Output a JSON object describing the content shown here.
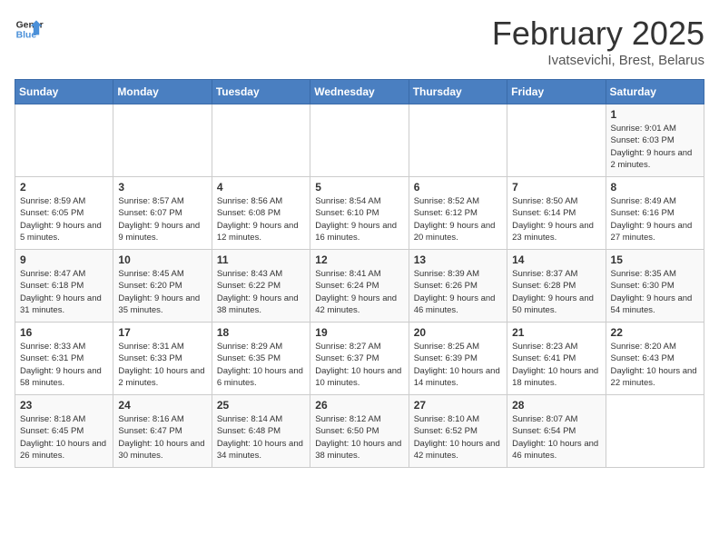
{
  "logo": {
    "line1": "General",
    "line2": "Blue"
  },
  "title": "February 2025",
  "subtitle": "Ivatsevichi, Brest, Belarus",
  "header": {
    "days": [
      "Sunday",
      "Monday",
      "Tuesday",
      "Wednesday",
      "Thursday",
      "Friday",
      "Saturday"
    ]
  },
  "weeks": [
    [
      {
        "day": "",
        "info": ""
      },
      {
        "day": "",
        "info": ""
      },
      {
        "day": "",
        "info": ""
      },
      {
        "day": "",
        "info": ""
      },
      {
        "day": "",
        "info": ""
      },
      {
        "day": "",
        "info": ""
      },
      {
        "day": "1",
        "info": "Sunrise: 9:01 AM\nSunset: 6:03 PM\nDaylight: 9 hours and 2 minutes."
      }
    ],
    [
      {
        "day": "2",
        "info": "Sunrise: 8:59 AM\nSunset: 6:05 PM\nDaylight: 9 hours and 5 minutes."
      },
      {
        "day": "3",
        "info": "Sunrise: 8:57 AM\nSunset: 6:07 PM\nDaylight: 9 hours and 9 minutes."
      },
      {
        "day": "4",
        "info": "Sunrise: 8:56 AM\nSunset: 6:08 PM\nDaylight: 9 hours and 12 minutes."
      },
      {
        "day": "5",
        "info": "Sunrise: 8:54 AM\nSunset: 6:10 PM\nDaylight: 9 hours and 16 minutes."
      },
      {
        "day": "6",
        "info": "Sunrise: 8:52 AM\nSunset: 6:12 PM\nDaylight: 9 hours and 20 minutes."
      },
      {
        "day": "7",
        "info": "Sunrise: 8:50 AM\nSunset: 6:14 PM\nDaylight: 9 hours and 23 minutes."
      },
      {
        "day": "8",
        "info": "Sunrise: 8:49 AM\nSunset: 6:16 PM\nDaylight: 9 hours and 27 minutes."
      }
    ],
    [
      {
        "day": "9",
        "info": "Sunrise: 8:47 AM\nSunset: 6:18 PM\nDaylight: 9 hours and 31 minutes."
      },
      {
        "day": "10",
        "info": "Sunrise: 8:45 AM\nSunset: 6:20 PM\nDaylight: 9 hours and 35 minutes."
      },
      {
        "day": "11",
        "info": "Sunrise: 8:43 AM\nSunset: 6:22 PM\nDaylight: 9 hours and 38 minutes."
      },
      {
        "day": "12",
        "info": "Sunrise: 8:41 AM\nSunset: 6:24 PM\nDaylight: 9 hours and 42 minutes."
      },
      {
        "day": "13",
        "info": "Sunrise: 8:39 AM\nSunset: 6:26 PM\nDaylight: 9 hours and 46 minutes."
      },
      {
        "day": "14",
        "info": "Sunrise: 8:37 AM\nSunset: 6:28 PM\nDaylight: 9 hours and 50 minutes."
      },
      {
        "day": "15",
        "info": "Sunrise: 8:35 AM\nSunset: 6:30 PM\nDaylight: 9 hours and 54 minutes."
      }
    ],
    [
      {
        "day": "16",
        "info": "Sunrise: 8:33 AM\nSunset: 6:31 PM\nDaylight: 9 hours and 58 minutes."
      },
      {
        "day": "17",
        "info": "Sunrise: 8:31 AM\nSunset: 6:33 PM\nDaylight: 10 hours and 2 minutes."
      },
      {
        "day": "18",
        "info": "Sunrise: 8:29 AM\nSunset: 6:35 PM\nDaylight: 10 hours and 6 minutes."
      },
      {
        "day": "19",
        "info": "Sunrise: 8:27 AM\nSunset: 6:37 PM\nDaylight: 10 hours and 10 minutes."
      },
      {
        "day": "20",
        "info": "Sunrise: 8:25 AM\nSunset: 6:39 PM\nDaylight: 10 hours and 14 minutes."
      },
      {
        "day": "21",
        "info": "Sunrise: 8:23 AM\nSunset: 6:41 PM\nDaylight: 10 hours and 18 minutes."
      },
      {
        "day": "22",
        "info": "Sunrise: 8:20 AM\nSunset: 6:43 PM\nDaylight: 10 hours and 22 minutes."
      }
    ],
    [
      {
        "day": "23",
        "info": "Sunrise: 8:18 AM\nSunset: 6:45 PM\nDaylight: 10 hours and 26 minutes."
      },
      {
        "day": "24",
        "info": "Sunrise: 8:16 AM\nSunset: 6:47 PM\nDaylight: 10 hours and 30 minutes."
      },
      {
        "day": "25",
        "info": "Sunrise: 8:14 AM\nSunset: 6:48 PM\nDaylight: 10 hours and 34 minutes."
      },
      {
        "day": "26",
        "info": "Sunrise: 8:12 AM\nSunset: 6:50 PM\nDaylight: 10 hours and 38 minutes."
      },
      {
        "day": "27",
        "info": "Sunrise: 8:10 AM\nSunset: 6:52 PM\nDaylight: 10 hours and 42 minutes."
      },
      {
        "day": "28",
        "info": "Sunrise: 8:07 AM\nSunset: 6:54 PM\nDaylight: 10 hours and 46 minutes."
      },
      {
        "day": "",
        "info": ""
      }
    ]
  ]
}
